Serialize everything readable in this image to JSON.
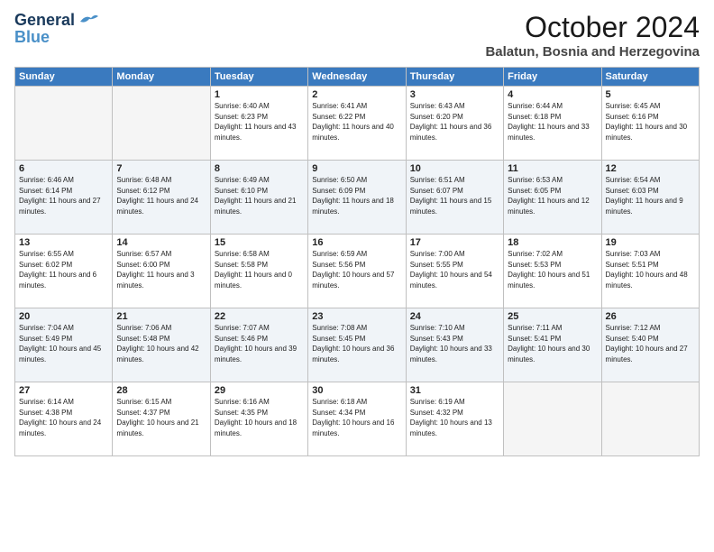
{
  "header": {
    "logo_line1": "General",
    "logo_line2": "Blue",
    "month": "October 2024",
    "location": "Balatun, Bosnia and Herzegovina"
  },
  "days_of_week": [
    "Sunday",
    "Monday",
    "Tuesday",
    "Wednesday",
    "Thursday",
    "Friday",
    "Saturday"
  ],
  "weeks": [
    [
      {
        "day": "",
        "sunrise": "",
        "sunset": "",
        "daylight": ""
      },
      {
        "day": "",
        "sunrise": "",
        "sunset": "",
        "daylight": ""
      },
      {
        "day": "1",
        "sunrise": "Sunrise: 6:40 AM",
        "sunset": "Sunset: 6:23 PM",
        "daylight": "Daylight: 11 hours and 43 minutes."
      },
      {
        "day": "2",
        "sunrise": "Sunrise: 6:41 AM",
        "sunset": "Sunset: 6:22 PM",
        "daylight": "Daylight: 11 hours and 40 minutes."
      },
      {
        "day": "3",
        "sunrise": "Sunrise: 6:43 AM",
        "sunset": "Sunset: 6:20 PM",
        "daylight": "Daylight: 11 hours and 36 minutes."
      },
      {
        "day": "4",
        "sunrise": "Sunrise: 6:44 AM",
        "sunset": "Sunset: 6:18 PM",
        "daylight": "Daylight: 11 hours and 33 minutes."
      },
      {
        "day": "5",
        "sunrise": "Sunrise: 6:45 AM",
        "sunset": "Sunset: 6:16 PM",
        "daylight": "Daylight: 11 hours and 30 minutes."
      }
    ],
    [
      {
        "day": "6",
        "sunrise": "Sunrise: 6:46 AM",
        "sunset": "Sunset: 6:14 PM",
        "daylight": "Daylight: 11 hours and 27 minutes."
      },
      {
        "day": "7",
        "sunrise": "Sunrise: 6:48 AM",
        "sunset": "Sunset: 6:12 PM",
        "daylight": "Daylight: 11 hours and 24 minutes."
      },
      {
        "day": "8",
        "sunrise": "Sunrise: 6:49 AM",
        "sunset": "Sunset: 6:10 PM",
        "daylight": "Daylight: 11 hours and 21 minutes."
      },
      {
        "day": "9",
        "sunrise": "Sunrise: 6:50 AM",
        "sunset": "Sunset: 6:09 PM",
        "daylight": "Daylight: 11 hours and 18 minutes."
      },
      {
        "day": "10",
        "sunrise": "Sunrise: 6:51 AM",
        "sunset": "Sunset: 6:07 PM",
        "daylight": "Daylight: 11 hours and 15 minutes."
      },
      {
        "day": "11",
        "sunrise": "Sunrise: 6:53 AM",
        "sunset": "Sunset: 6:05 PM",
        "daylight": "Daylight: 11 hours and 12 minutes."
      },
      {
        "day": "12",
        "sunrise": "Sunrise: 6:54 AM",
        "sunset": "Sunset: 6:03 PM",
        "daylight": "Daylight: 11 hours and 9 minutes."
      }
    ],
    [
      {
        "day": "13",
        "sunrise": "Sunrise: 6:55 AM",
        "sunset": "Sunset: 6:02 PM",
        "daylight": "Daylight: 11 hours and 6 minutes."
      },
      {
        "day": "14",
        "sunrise": "Sunrise: 6:57 AM",
        "sunset": "Sunset: 6:00 PM",
        "daylight": "Daylight: 11 hours and 3 minutes."
      },
      {
        "day": "15",
        "sunrise": "Sunrise: 6:58 AM",
        "sunset": "Sunset: 5:58 PM",
        "daylight": "Daylight: 11 hours and 0 minutes."
      },
      {
        "day": "16",
        "sunrise": "Sunrise: 6:59 AM",
        "sunset": "Sunset: 5:56 PM",
        "daylight": "Daylight: 10 hours and 57 minutes."
      },
      {
        "day": "17",
        "sunrise": "Sunrise: 7:00 AM",
        "sunset": "Sunset: 5:55 PM",
        "daylight": "Daylight: 10 hours and 54 minutes."
      },
      {
        "day": "18",
        "sunrise": "Sunrise: 7:02 AM",
        "sunset": "Sunset: 5:53 PM",
        "daylight": "Daylight: 10 hours and 51 minutes."
      },
      {
        "day": "19",
        "sunrise": "Sunrise: 7:03 AM",
        "sunset": "Sunset: 5:51 PM",
        "daylight": "Daylight: 10 hours and 48 minutes."
      }
    ],
    [
      {
        "day": "20",
        "sunrise": "Sunrise: 7:04 AM",
        "sunset": "Sunset: 5:49 PM",
        "daylight": "Daylight: 10 hours and 45 minutes."
      },
      {
        "day": "21",
        "sunrise": "Sunrise: 7:06 AM",
        "sunset": "Sunset: 5:48 PM",
        "daylight": "Daylight: 10 hours and 42 minutes."
      },
      {
        "day": "22",
        "sunrise": "Sunrise: 7:07 AM",
        "sunset": "Sunset: 5:46 PM",
        "daylight": "Daylight: 10 hours and 39 minutes."
      },
      {
        "day": "23",
        "sunrise": "Sunrise: 7:08 AM",
        "sunset": "Sunset: 5:45 PM",
        "daylight": "Daylight: 10 hours and 36 minutes."
      },
      {
        "day": "24",
        "sunrise": "Sunrise: 7:10 AM",
        "sunset": "Sunset: 5:43 PM",
        "daylight": "Daylight: 10 hours and 33 minutes."
      },
      {
        "day": "25",
        "sunrise": "Sunrise: 7:11 AM",
        "sunset": "Sunset: 5:41 PM",
        "daylight": "Daylight: 10 hours and 30 minutes."
      },
      {
        "day": "26",
        "sunrise": "Sunrise: 7:12 AM",
        "sunset": "Sunset: 5:40 PM",
        "daylight": "Daylight: 10 hours and 27 minutes."
      }
    ],
    [
      {
        "day": "27",
        "sunrise": "Sunrise: 6:14 AM",
        "sunset": "Sunset: 4:38 PM",
        "daylight": "Daylight: 10 hours and 24 minutes."
      },
      {
        "day": "28",
        "sunrise": "Sunrise: 6:15 AM",
        "sunset": "Sunset: 4:37 PM",
        "daylight": "Daylight: 10 hours and 21 minutes."
      },
      {
        "day": "29",
        "sunrise": "Sunrise: 6:16 AM",
        "sunset": "Sunset: 4:35 PM",
        "daylight": "Daylight: 10 hours and 18 minutes."
      },
      {
        "day": "30",
        "sunrise": "Sunrise: 6:18 AM",
        "sunset": "Sunset: 4:34 PM",
        "daylight": "Daylight: 10 hours and 16 minutes."
      },
      {
        "day": "31",
        "sunrise": "Sunrise: 6:19 AM",
        "sunset": "Sunset: 4:32 PM",
        "daylight": "Daylight: 10 hours and 13 minutes."
      },
      {
        "day": "",
        "sunrise": "",
        "sunset": "",
        "daylight": ""
      },
      {
        "day": "",
        "sunrise": "",
        "sunset": "",
        "daylight": ""
      }
    ]
  ]
}
